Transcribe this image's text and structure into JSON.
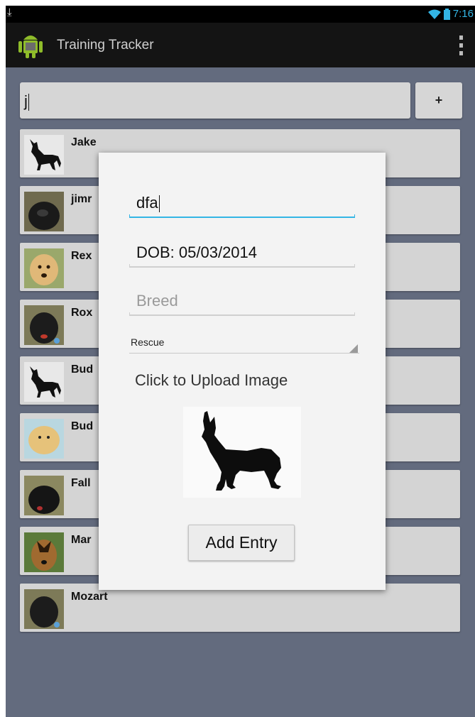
{
  "status_bar": {
    "time": "7:16"
  },
  "action_bar": {
    "title": "Training Tracker",
    "logo_icon": "android-icon",
    "overflow_icon": "overflow-menu-icon"
  },
  "search": {
    "value": "j"
  },
  "add_button": {
    "label": "+"
  },
  "dog_list": [
    {
      "name": "Jake",
      "thumb": "silhouette"
    },
    {
      "name": "jimr",
      "thumb": "photo-black"
    },
    {
      "name": "Rex",
      "thumb": "photo-golden"
    },
    {
      "name": "Rox",
      "thumb": "photo-black"
    },
    {
      "name": "Bud",
      "thumb": "silhouette"
    },
    {
      "name": "Bud",
      "thumb": "photo-plush"
    },
    {
      "name": "Fall",
      "thumb": "photo-black"
    },
    {
      "name": "Mar",
      "thumb": "photo-shepherd"
    },
    {
      "name": "Mozart",
      "thumb": "photo-black"
    }
  ],
  "dialog": {
    "name_field": {
      "value": "dfa"
    },
    "dob_field": {
      "value": "DOB: 05/03/2014"
    },
    "breed_field": {
      "placeholder": "Breed"
    },
    "type_spinner": {
      "selected": "Rescue"
    },
    "upload_label": "Click to Upload Image",
    "add_entry_label": "Add Entry"
  },
  "colors": {
    "accent": "#33b5e5",
    "background": "#636b7e",
    "row_background": "#d4d4d4",
    "dialog_background": "#f3f3f3"
  }
}
